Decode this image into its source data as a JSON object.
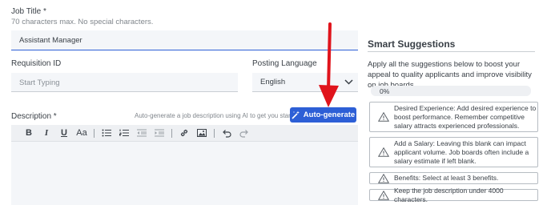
{
  "job_title": {
    "label": "Job Title *",
    "hint": "70 characters max. No special characters.",
    "value": "Assistant Manager"
  },
  "requisition": {
    "label": "Requisition ID",
    "placeholder": "Start Typing"
  },
  "posting_language": {
    "label": "Posting Language",
    "value": "English"
  },
  "description": {
    "label": "Description *",
    "ai_hint": "Auto-generate a job description using AI to get you started",
    "ai_button": "Auto-generate",
    "toolbar": {
      "bold": "B",
      "italic": "I",
      "underline": "U",
      "font_size": "Aa"
    }
  },
  "suggestions": {
    "title": "Smart Suggestions",
    "intro": "Apply all the suggestions below to boost your appeal to quality applicants and improve visibility on job boards.",
    "progress_label": "0%",
    "progress_value": 0,
    "items": [
      "Desired Experience: Add desired experience to boost performance. Remember competitive salary attracts experienced professionals.",
      "Add a Salary: Leaving this blank can impact applicant volume. Job boards often include a salary estimate if left blank.",
      "Benefits: Select at least 3 benefits.",
      "Keep the job description under 4000 characters."
    ]
  },
  "colors": {
    "accent": "#2d5fd6",
    "annotation_arrow": "#e0141c"
  }
}
